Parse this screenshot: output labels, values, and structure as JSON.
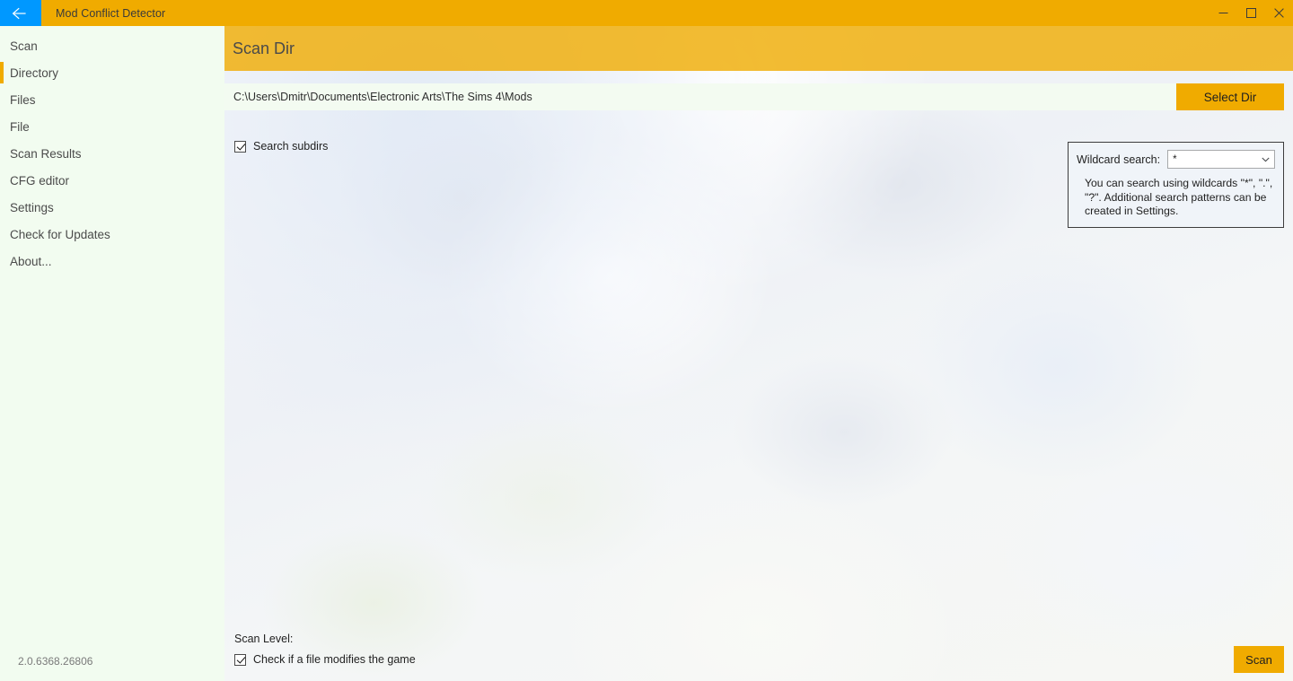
{
  "window": {
    "title": "Mod Conflict Detector",
    "back_icon": "back-arrow-icon",
    "minimize_icon": "minimize-icon",
    "maximize_icon": "maximize-icon",
    "close_icon": "close-icon",
    "accent_gold": "#f0ab00",
    "accent_blue": "#0098ff"
  },
  "sidebar": {
    "background": "#f2fcf0",
    "active_item": "Directory",
    "items": [
      {
        "label": "Scan",
        "active": false
      },
      {
        "label": "Directory",
        "active": true
      },
      {
        "label": "Files",
        "active": false
      },
      {
        "label": "File",
        "active": false
      },
      {
        "label": "Scan Results",
        "active": false
      },
      {
        "label": "CFG editor",
        "active": false
      },
      {
        "label": "Settings",
        "active": false
      },
      {
        "label": "Check for Updates",
        "active": false
      },
      {
        "label": "About...",
        "active": false
      }
    ],
    "version": "2.0.6368.26806"
  },
  "header": {
    "title": "Scan Dir"
  },
  "directory": {
    "path_value": "C:\\Users\\Dmitr\\Documents\\Electronic Arts\\The Sims 4\\Mods",
    "path_placeholder": "C:\\Users\\Dmitr\\Documents\\Electronic Arts\\The Sims 4\\Mods",
    "select_dir_label": "Select Dir",
    "search_subdirs_label": "Search subdirs",
    "search_subdirs_checked": true
  },
  "wildcard": {
    "label": "Wildcard search:",
    "selected_value": "*",
    "options": [
      "*"
    ],
    "chevron_icon": "chevron-down-icon",
    "hint": "You can search using wildcards \"*\", \".\", \"?\". Additional search patterns can be created in Settings."
  },
  "scan_level": {
    "label": "Scan Level:",
    "option_label": "Check if a file modifies the game",
    "option_checked": true
  },
  "actions": {
    "scan_label": "Scan"
  }
}
